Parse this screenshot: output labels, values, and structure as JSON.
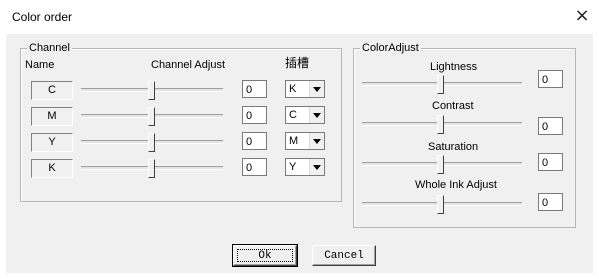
{
  "window": {
    "title": "Color order",
    "close_glyph": "×"
  },
  "channel": {
    "legend": "Channel",
    "name_header": "Name",
    "adjust_header": "Channel Adjust",
    "slot_header": "插槽",
    "rows": [
      {
        "name": "C",
        "value": "0",
        "slot": "K"
      },
      {
        "name": "M",
        "value": "0",
        "slot": "C"
      },
      {
        "name": "Y",
        "value": "0",
        "slot": "M"
      },
      {
        "name": "K",
        "value": "0",
        "slot": "Y"
      }
    ]
  },
  "color_adjust": {
    "legend": "ColorAdjust",
    "items": [
      {
        "label": "Lightness",
        "value": "0"
      },
      {
        "label": "Contrast",
        "value": "0"
      },
      {
        "label": "Saturation",
        "value": "0"
      },
      {
        "label": "Whole Ink Adjust",
        "value": "0"
      }
    ]
  },
  "buttons": {
    "ok": "Ok",
    "cancel": "Cancel"
  }
}
